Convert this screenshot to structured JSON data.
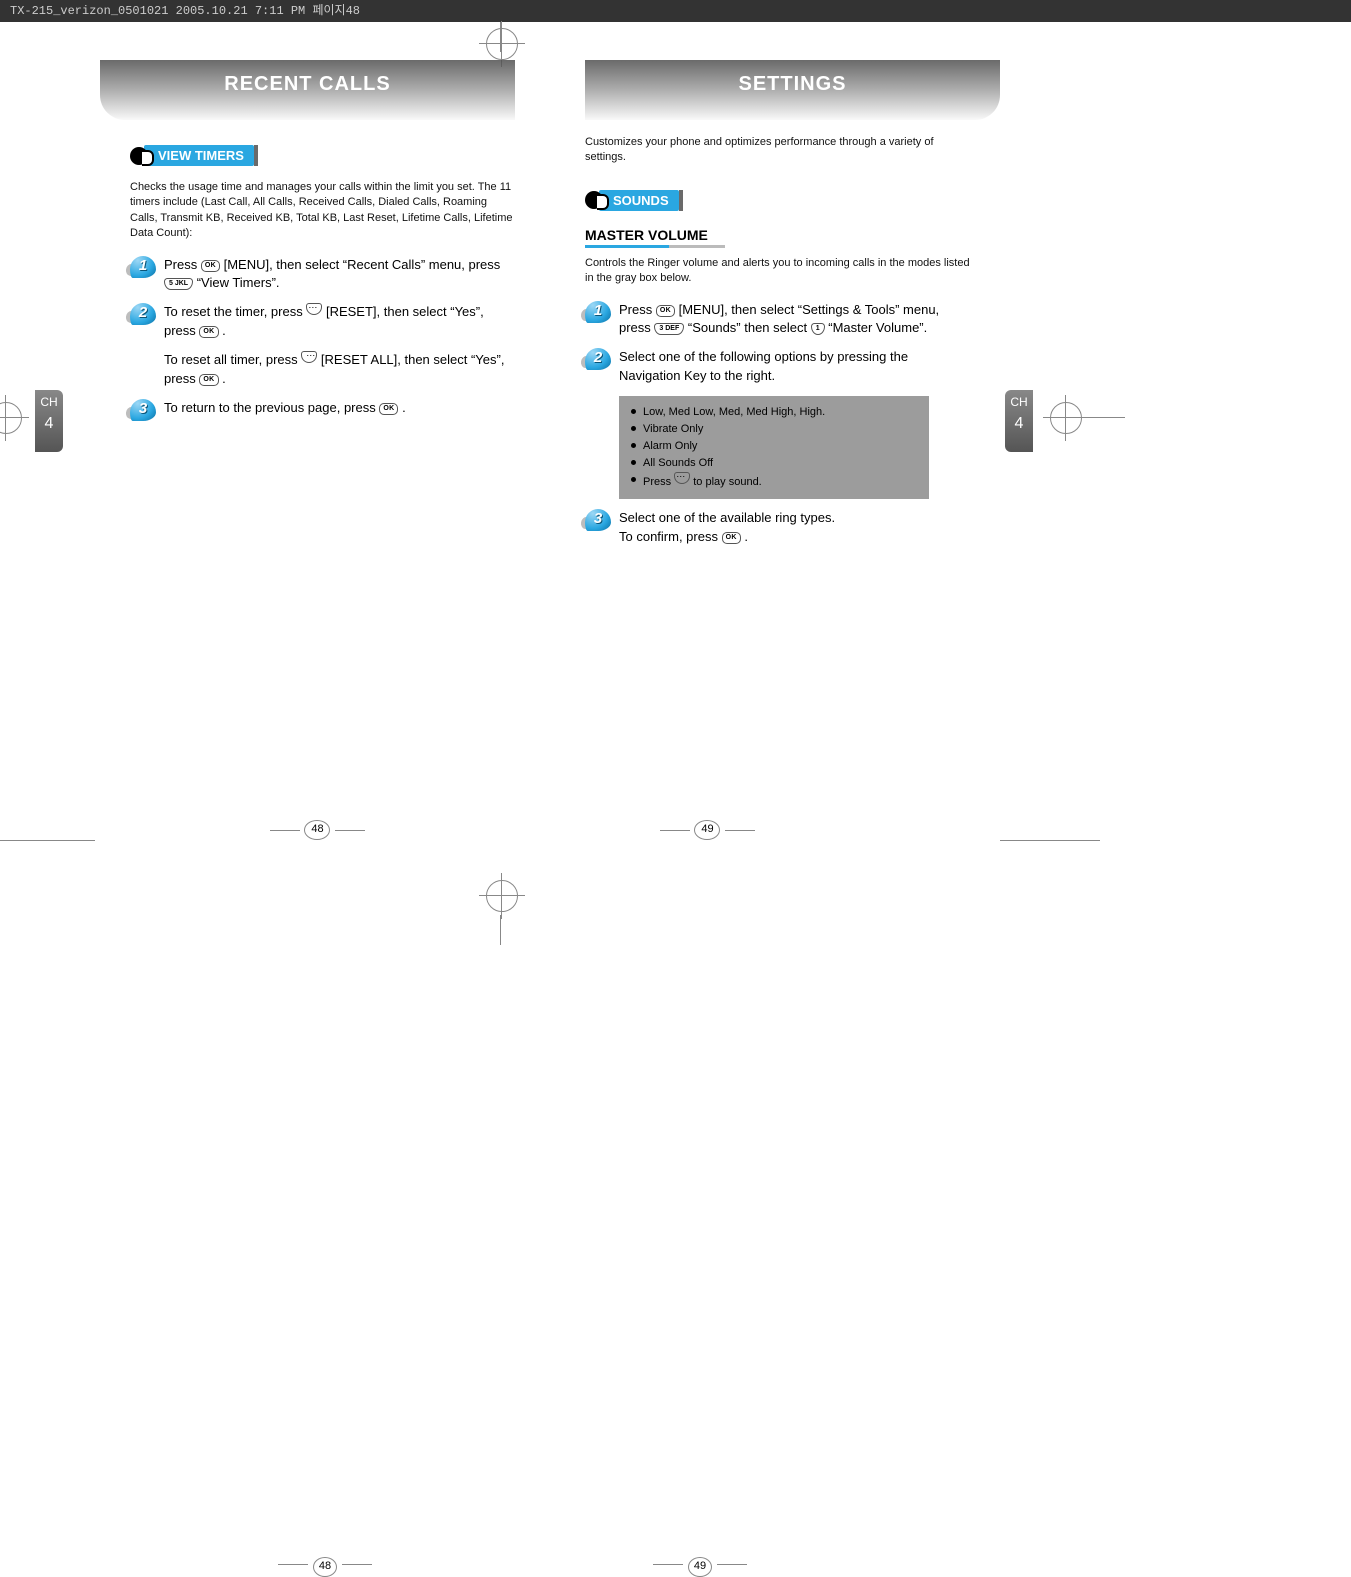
{
  "header_strip": "TX-215_verizon_0501021  2005.10.21  7:11 PM  페이지48",
  "chapter_tab": {
    "label": "CH",
    "number": "4"
  },
  "left_page": {
    "title": "RECENT CALLS",
    "section": "VIEW TIMERS",
    "intro": "Checks the usage time and manages your calls within the limit you set. The 11 timers include (Last Call, All Calls, Received Calls, Dialed Calls, Roaming Calls, Transmit KB, Received KB, Total KB, Last Reset, Lifetime Calls, Lifetime Data Count):",
    "step1a": "Press ",
    "step1b": " [MENU], then select “Recent Calls” menu, press ",
    "step1c": " “View Timers”.",
    "step2a": "To reset the timer, press ",
    "step2b": " [RESET], then select “Yes”, press ",
    "step2c": " .",
    "step2d": "To reset all timer, press ",
    "step2e": " [RESET ALL], then select “Yes”, press ",
    "step2f": " .",
    "step3a": "To return to the previous page, press ",
    "step3b": " .",
    "page_number": "48",
    "key_ok": "OK",
    "key_5": "5 JKL"
  },
  "right_page": {
    "title": "SETTINGS",
    "intro_top": "Customizes your phone and optimizes performance through a variety of settings.",
    "section": "SOUNDS",
    "subheading": "MASTER VOLUME",
    "sub_intro": "Controls the Ringer volume and alerts you to incoming calls in the modes listed in the gray box below.",
    "step1a": "Press ",
    "step1b": " [MENU], then select “Settings & Tools” menu, press ",
    "step1c": " “Sounds” then select ",
    "step1d": " “Master Volume”.",
    "step2": "Select one of the following options by pressing the Navigation Key to the right.",
    "box": {
      "r1": "Low, Med Low, Med, Med High, High.",
      "r2": "Vibrate Only",
      "r3": "Alarm Only",
      "r4": "All Sounds Off",
      "r5a": "Press ",
      "r5b": " to play sound."
    },
    "step3a": "Select one of the available ring types.",
    "step3b": "To confirm, press ",
    "step3c": " .",
    "page_number": "49",
    "key_ok": "OK",
    "key_3": "3 DEF",
    "key_1": "1"
  }
}
